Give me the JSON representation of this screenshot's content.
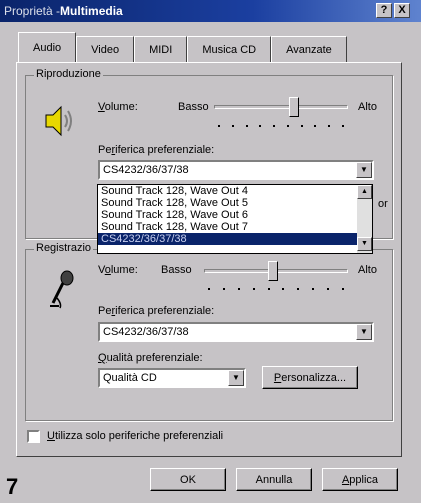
{
  "window": {
    "title_prefix": "Proprietà - ",
    "title": "Multimedia",
    "help_button": "?",
    "close_button": "X"
  },
  "tabs": [
    {
      "label": "Audio",
      "active": true
    },
    {
      "label": "Video",
      "active": false
    },
    {
      "label": "MIDI",
      "active": false
    },
    {
      "label": "Musica CD",
      "active": false
    },
    {
      "label": "Avanzate",
      "active": false
    }
  ],
  "playback": {
    "group_title": "Riproduzione",
    "volume_label": "Volume:",
    "volume_low": "Basso",
    "volume_high": "Alto",
    "volume_level": 0.6,
    "device_label": "Periferica preferenziale:",
    "device_value": "CS4232/36/37/38",
    "dropdown_items": [
      "Sound Track 128, Wave Out 4",
      "Sound Track 128, Wave Out 5",
      "Sound Track 128, Wave Out 6",
      "Sound Track 128, Wave Out 7",
      "CS4232/36/37/38"
    ],
    "dropdown_selected_index": 4,
    "partial_text": "or"
  },
  "recording": {
    "group_title": "Registrazio",
    "volume_label": "Volume:",
    "volume_low": "Basso",
    "volume_high": "Alto",
    "volume_level": 0.48,
    "device_label": "Periferica preferenziale:",
    "device_value": "CS4232/36/37/38",
    "quality_label": "Qualità preferenziale:",
    "quality_value": "Qualità CD",
    "customize_button": "Personalizza..."
  },
  "preferred_only_checkbox": {
    "label": "Utilizza solo periferiche preferenziali",
    "checked": false
  },
  "footer": {
    "ok": "OK",
    "cancel": "Annulla",
    "apply": "Applica"
  },
  "figure_number": "7"
}
